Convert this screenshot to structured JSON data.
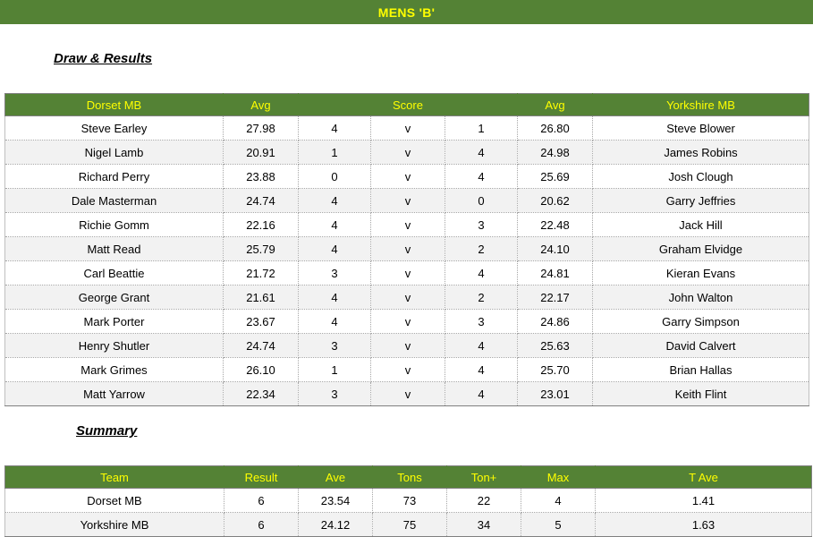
{
  "banner": {
    "title": "MENS 'B'"
  },
  "colors": {
    "header_green": "#548235",
    "header_text_yellow": "#FFFF00",
    "alt_row": "#F2F2F2",
    "grid": "#a6a6a6"
  },
  "sections": {
    "draw_results_heading": "Draw & Results",
    "summary_heading": "Summary"
  },
  "draw_results": {
    "headers": {
      "home_team": "Dorset MB",
      "home_avg": "Avg",
      "score": "Score",
      "away_avg": "Avg",
      "away_team": "Yorkshire MB"
    },
    "rows": [
      {
        "home_player": "Steve Earley",
        "home_avg": "27.98",
        "home_score": "4",
        "vs": "v",
        "away_score": "1",
        "away_avg": "26.80",
        "away_player": "Steve Blower"
      },
      {
        "home_player": "Nigel Lamb",
        "home_avg": "20.91",
        "home_score": "1",
        "vs": "v",
        "away_score": "4",
        "away_avg": "24.98",
        "away_player": "James Robins"
      },
      {
        "home_player": "Richard Perry",
        "home_avg": "23.88",
        "home_score": "0",
        "vs": "v",
        "away_score": "4",
        "away_avg": "25.69",
        "away_player": "Josh Clough"
      },
      {
        "home_player": "Dale Masterman",
        "home_avg": "24.74",
        "home_score": "4",
        "vs": "v",
        "away_score": "0",
        "away_avg": "20.62",
        "away_player": "Garry Jeffries"
      },
      {
        "home_player": "Richie Gomm",
        "home_avg": "22.16",
        "home_score": "4",
        "vs": "v",
        "away_score": "3",
        "away_avg": "22.48",
        "away_player": "Jack Hill"
      },
      {
        "home_player": "Matt Read",
        "home_avg": "25.79",
        "home_score": "4",
        "vs": "v",
        "away_score": "2",
        "away_avg": "24.10",
        "away_player": "Graham Elvidge"
      },
      {
        "home_player": "Carl Beattie",
        "home_avg": "21.72",
        "home_score": "3",
        "vs": "v",
        "away_score": "4",
        "away_avg": "24.81",
        "away_player": "Kieran Evans"
      },
      {
        "home_player": "George Grant",
        "home_avg": "21.61",
        "home_score": "4",
        "vs": "v",
        "away_score": "2",
        "away_avg": "22.17",
        "away_player": "John Walton"
      },
      {
        "home_player": "Mark Porter",
        "home_avg": "23.67",
        "home_score": "4",
        "vs": "v",
        "away_score": "3",
        "away_avg": "24.86",
        "away_player": "Garry Simpson"
      },
      {
        "home_player": "Henry Shutler",
        "home_avg": "24.74",
        "home_score": "3",
        "vs": "v",
        "away_score": "4",
        "away_avg": "25.63",
        "away_player": "David Calvert"
      },
      {
        "home_player": "Mark Grimes",
        "home_avg": "26.10",
        "home_score": "1",
        "vs": "v",
        "away_score": "4",
        "away_avg": "25.70",
        "away_player": "Brian Hallas"
      },
      {
        "home_player": "Matt Yarrow",
        "home_avg": "22.34",
        "home_score": "3",
        "vs": "v",
        "away_score": "4",
        "away_avg": "23.01",
        "away_player": "Keith Flint"
      }
    ]
  },
  "summary": {
    "headers": {
      "team": "Team",
      "result": "Result",
      "ave": "Ave",
      "tons": "Tons",
      "ton_plus": "Ton+",
      "max": "Max",
      "t_ave": "T Ave"
    },
    "rows": [
      {
        "team": "Dorset MB",
        "result": "6",
        "ave": "23.54",
        "tons": "73",
        "ton_plus": "22",
        "max": "4",
        "t_ave": "1.41"
      },
      {
        "team": "Yorkshire MB",
        "result": "6",
        "ave": "24.12",
        "tons": "75",
        "ton_plus": "34",
        "max": "5",
        "t_ave": "1.63"
      }
    ]
  }
}
